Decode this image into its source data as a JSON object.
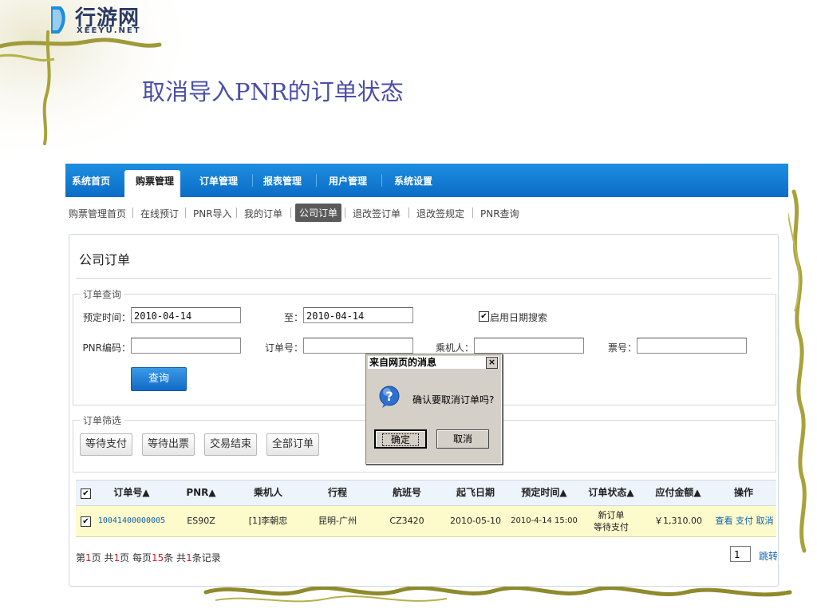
{
  "logo": {
    "name": "行游网",
    "sub": "XEEYU.NET"
  },
  "slide_title": "取消导入PNR的订单状态",
  "nav": {
    "items": [
      "系统首页",
      "购票管理",
      "订单管理",
      "报表管理",
      "用户管理",
      "系统设置"
    ],
    "active": "购票管理"
  },
  "subnav": {
    "items": [
      "购票管理首页",
      "在线预订",
      "PNR导入",
      "我的订单",
      "公司订单",
      "退改签订单",
      "退改签规定",
      "PNR查询"
    ],
    "active": "公司订单"
  },
  "panel": {
    "title": "公司订单"
  },
  "query": {
    "legend": "订单查询",
    "start_label": "预定时间：",
    "start_value": "2010-04-14",
    "end_label": "至：",
    "end_value": "2010-04-14",
    "enable_date_label": "启用日期搜索",
    "enable_date_checked": true,
    "pnr_label": "PNR编码：",
    "pnr_value": "",
    "order_label": "订单号：",
    "order_value": "",
    "passenger_label": "乘机人：",
    "passenger_value": "",
    "ticket_label": "票号：",
    "ticket_value": "",
    "submit": "查询"
  },
  "filter": {
    "legend": "订单筛选",
    "buttons": [
      "等待支付",
      "等待出票",
      "交易结束",
      "全部订单"
    ]
  },
  "table": {
    "headers": [
      "订单号▲",
      "PNR▲",
      "乘机人",
      "行程",
      "航班号",
      "起飞日期",
      "预定时间▲",
      "订单状态▲",
      "应付金额▲",
      "操作"
    ],
    "header_checked": true,
    "rows": [
      {
        "checked": true,
        "order_no": "10041400000005",
        "pnr": "ES90Z",
        "passenger": "[1]李朝忠",
        "route": "昆明-广州",
        "flight": "CZ3420",
        "depart": "2010-05-10",
        "booked": "2010-4-14 15:00",
        "status_line1": "新订单",
        "status_line2": "等待支付",
        "amount": "￥1,310.00",
        "actions": [
          "查看",
          "支付",
          "取消"
        ]
      }
    ]
  },
  "pager": {
    "p1": "第",
    "page": "1",
    "p2": "页 共",
    "total_pages": "1",
    "p3": "页 每页",
    "per_page": "15",
    "p4": "条 共",
    "records": "1",
    "p5": "条记录",
    "jump_value": "1",
    "jump": "跳转"
  },
  "dialog": {
    "title": "来自网页的消息",
    "close": "×",
    "message": "确认要取消订单吗?",
    "ok": "确定",
    "cancel": "取消"
  },
  "colors": {
    "nav_bg": "#0b6cc6",
    "title": "#4a4fa8",
    "row_highlight": "#fdfbcc",
    "link": "#1060b0",
    "vine": "#a8a23a"
  }
}
